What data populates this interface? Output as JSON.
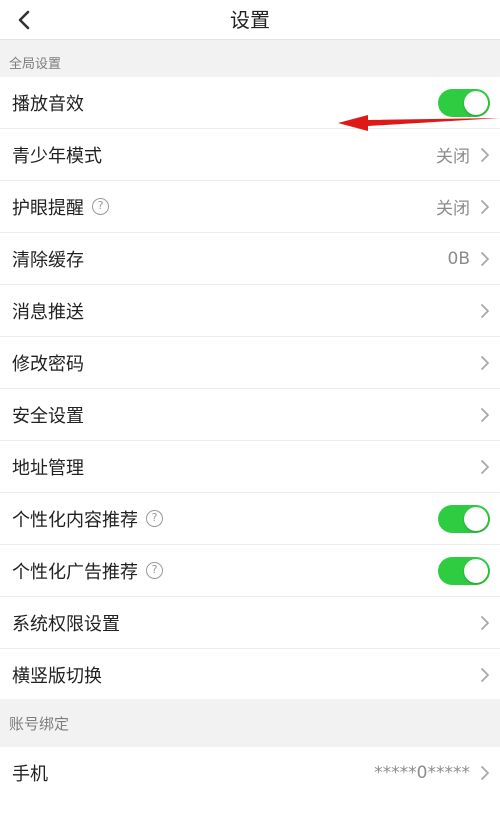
{
  "header": {
    "title": "设置"
  },
  "colors": {
    "accent_switch": "#2ecc40",
    "annotation_arrow": "#e01818"
  },
  "sections": [
    {
      "title": "全局设置",
      "rows": [
        {
          "label": "播放音效",
          "type": "switch",
          "on": true
        },
        {
          "label": "青少年模式",
          "type": "value",
          "value": "关闭"
        },
        {
          "label": "护眼提醒",
          "type": "value",
          "value": "关闭",
          "help": true
        },
        {
          "label": "清除缓存",
          "type": "value",
          "value": "0B"
        },
        {
          "label": "消息推送",
          "type": "nav"
        },
        {
          "label": "修改密码",
          "type": "nav"
        },
        {
          "label": "安全设置",
          "type": "nav"
        },
        {
          "label": "地址管理",
          "type": "nav"
        },
        {
          "label": "个性化内容推荐",
          "type": "switch",
          "on": true,
          "help": true
        },
        {
          "label": "个性化广告推荐",
          "type": "switch",
          "on": true,
          "help": true
        },
        {
          "label": "系统权限设置",
          "type": "nav"
        },
        {
          "label": "横竖版切换",
          "type": "nav"
        }
      ]
    },
    {
      "title": "账号绑定",
      "rows": [
        {
          "label": "手机",
          "type": "value",
          "value": "*****0*****"
        }
      ]
    }
  ],
  "icons": {
    "back": "chevron-left-icon",
    "help": "question-circle-icon",
    "row_arrow": "chevron-right-icon"
  },
  "glyphs": {
    "help": "?"
  }
}
